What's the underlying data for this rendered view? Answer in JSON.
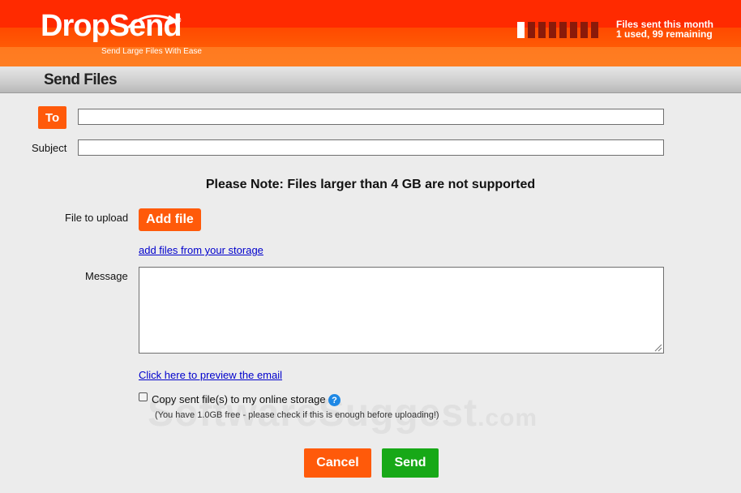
{
  "header": {
    "logo_text": "DropSend",
    "logo_registered": "®",
    "logo_tagline": "Send Large Files With Ease",
    "files_sent_title": "Files sent this month",
    "files_sent_status": "1 used, 99 remaining",
    "meter": {
      "used": 1,
      "total_segments": 8
    }
  },
  "page": {
    "title": "Send Files"
  },
  "form": {
    "to_label": "To",
    "to_value": "",
    "subject_label": "Subject",
    "subject_value": "",
    "note": "Please Note: Files larger than 4 GB are not supported",
    "file_label": "File to upload",
    "add_file_label": "Add file",
    "storage_link": "add files from your storage",
    "message_label": "Message",
    "message_value": "",
    "preview_link": "Click here to preview the email",
    "copy_checkbox_label": "Copy sent file(s) to my online storage",
    "copy_checked": false,
    "help_glyph": "?",
    "storage_note": "(You have 1.0GB free - please check if this is enough before uploading!)"
  },
  "actions": {
    "cancel_label": "Cancel",
    "send_label": "Send"
  },
  "watermark": {
    "main": "SoftwareSuggest",
    "suffix": ".com"
  },
  "colors": {
    "brand_orange": "#ff5a0a",
    "header_red": "#ff2a00",
    "send_green": "#17a817",
    "link_blue": "#0000cc",
    "help_blue": "#1e88e5"
  },
  "icons": {
    "help": "help-icon",
    "resize": "resize-grip-icon",
    "logo_arc": "send-arc-icon"
  }
}
